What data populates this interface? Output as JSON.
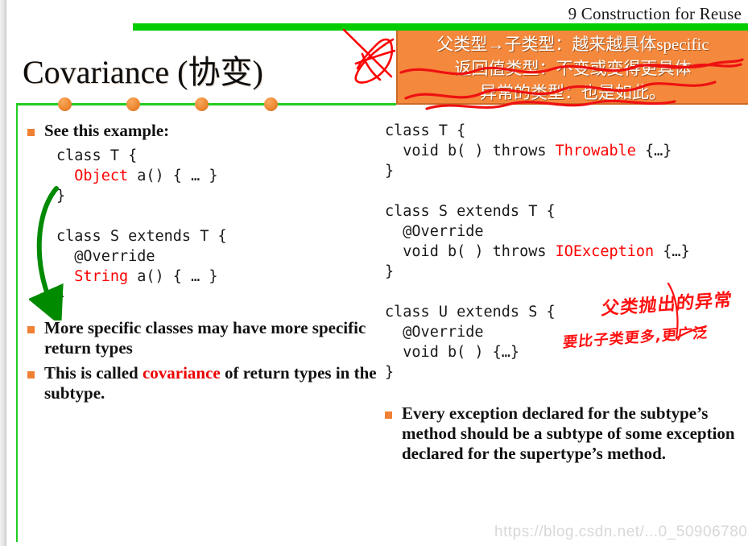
{
  "header": {
    "running_title": "9 Construction for Reuse"
  },
  "title": {
    "text": "Covariance (协变)"
  },
  "callout": {
    "lines": [
      "父类型→子类型：越来越具体specific",
      "返回值类型：不变或变得更具体",
      "异常的类型：也是如此。"
    ],
    "bg_color": "#f4883c",
    "text_color": "#ffffff",
    "annotation_color": "#ee1111"
  },
  "divider": {
    "line_color": "#22cc22",
    "dot_color": "#ee8a33",
    "dot_positions": [
      80,
      165,
      250,
      336
    ]
  },
  "left_column": {
    "bullets": [
      {
        "id": "see-this-example",
        "text": "See this example:"
      }
    ],
    "code": [
      {
        "text": "class T {",
        "color": "black"
      },
      {
        "text": "  ",
        "color": "black",
        "tail": "Object",
        "tail_color": "red",
        "rest": " a() { … }"
      },
      {
        "text": "}",
        "color": "black"
      },
      {
        "text": "",
        "color": "black"
      },
      {
        "text": "class S extends T {",
        "color": "black"
      },
      {
        "text": "  @Override",
        "color": "black"
      },
      {
        "text": "  ",
        "color": "black",
        "tail": "String",
        "tail_color": "red",
        "rest": " a() { … }"
      },
      {
        "text": "}",
        "color": "black"
      }
    ],
    "code_plain": "class T {\n  Object a() { … }\n}\n\nclass S extends T {\n  @Override\n  String a() { … }\n}",
    "bullets_after": [
      {
        "id": "more-specific-classes",
        "text": "More specific classes may have more specific return types"
      },
      {
        "id": "this-is-called-covariance",
        "prefix": "This is called ",
        "highlight": "covariance",
        "suffix": " of return types in the subtype."
      }
    ]
  },
  "right_column": {
    "code_blocks": [
      {
        "id": "class-t",
        "lines": [
          {
            "plain": "class T {"
          },
          {
            "prefix": "  void b( ) throws ",
            "highlight": "Throwable",
            "suffix": " {…}"
          },
          {
            "plain": "}"
          }
        ]
      },
      {
        "id": "class-s",
        "lines": [
          {
            "plain": "class S extends T {"
          },
          {
            "plain": "  @Override"
          },
          {
            "prefix": "  void b( ) throws ",
            "highlight": "IOException",
            "suffix": " {…}"
          },
          {
            "plain": "}"
          }
        ]
      },
      {
        "id": "class-u",
        "lines": [
          {
            "plain": "class U extends S {"
          },
          {
            "plain": "  @Override"
          },
          {
            "plain": "  void b( ) {…}"
          },
          {
            "plain": "}"
          }
        ]
      }
    ],
    "bullet": {
      "id": "every-exception-declared",
      "text": "Every exception declared for the subtype’s method should be a subtype of some exception declared for the supertype’s method."
    }
  },
  "handwritten_notes": [
    {
      "id": "note-parent-throws",
      "text": "父类抛出的异常"
    },
    {
      "id": "note-more-broad",
      "text": "要比子类更多,更广泛"
    }
  ],
  "watermark": {
    "text": "https://blog.csdn.net/...0_50906780"
  },
  "colors": {
    "green": "#00cc00",
    "orange": "#f4883c",
    "bullet_orange": "#f08033",
    "code_red": "#ff0000",
    "pen_red": "#ff1010"
  }
}
